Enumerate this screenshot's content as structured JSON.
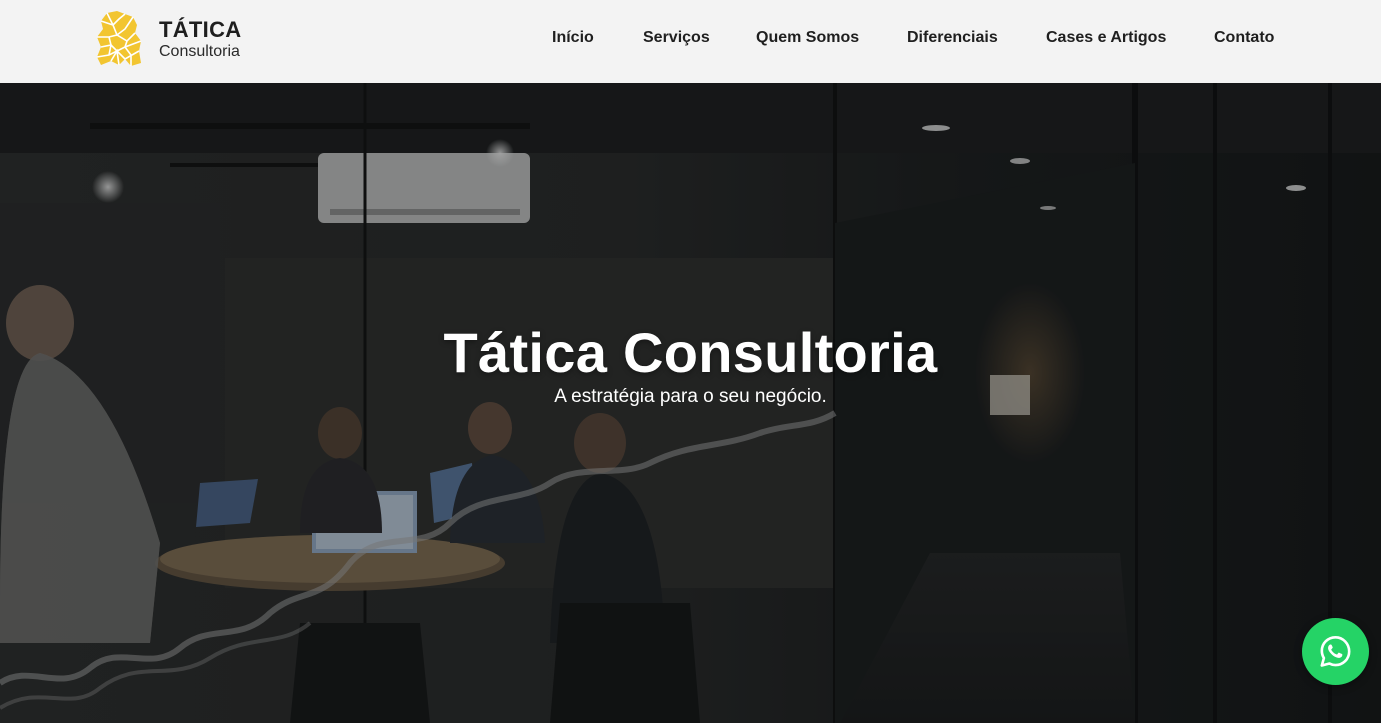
{
  "brand": {
    "title": "TÁTICA",
    "subtitle": "Consultoria",
    "logo_icon": "lion-head-icon",
    "logo_color": "#f2c530"
  },
  "nav": {
    "items": [
      {
        "label": "Início"
      },
      {
        "label": "Serviços"
      },
      {
        "label": "Quem Somos"
      },
      {
        "label": "Diferenciais"
      },
      {
        "label": "Cases e Artigos"
      },
      {
        "label": "Contato"
      }
    ]
  },
  "hero": {
    "title": "Tática Consultoria",
    "subtitle": "A estratégia para o seu negócio."
  },
  "whatsapp": {
    "icon": "whatsapp-icon",
    "color": "#25d366"
  },
  "colors": {
    "header_bg": "#f3f3f3",
    "nav_text": "#1f1f1f",
    "hero_text": "#ffffff"
  }
}
